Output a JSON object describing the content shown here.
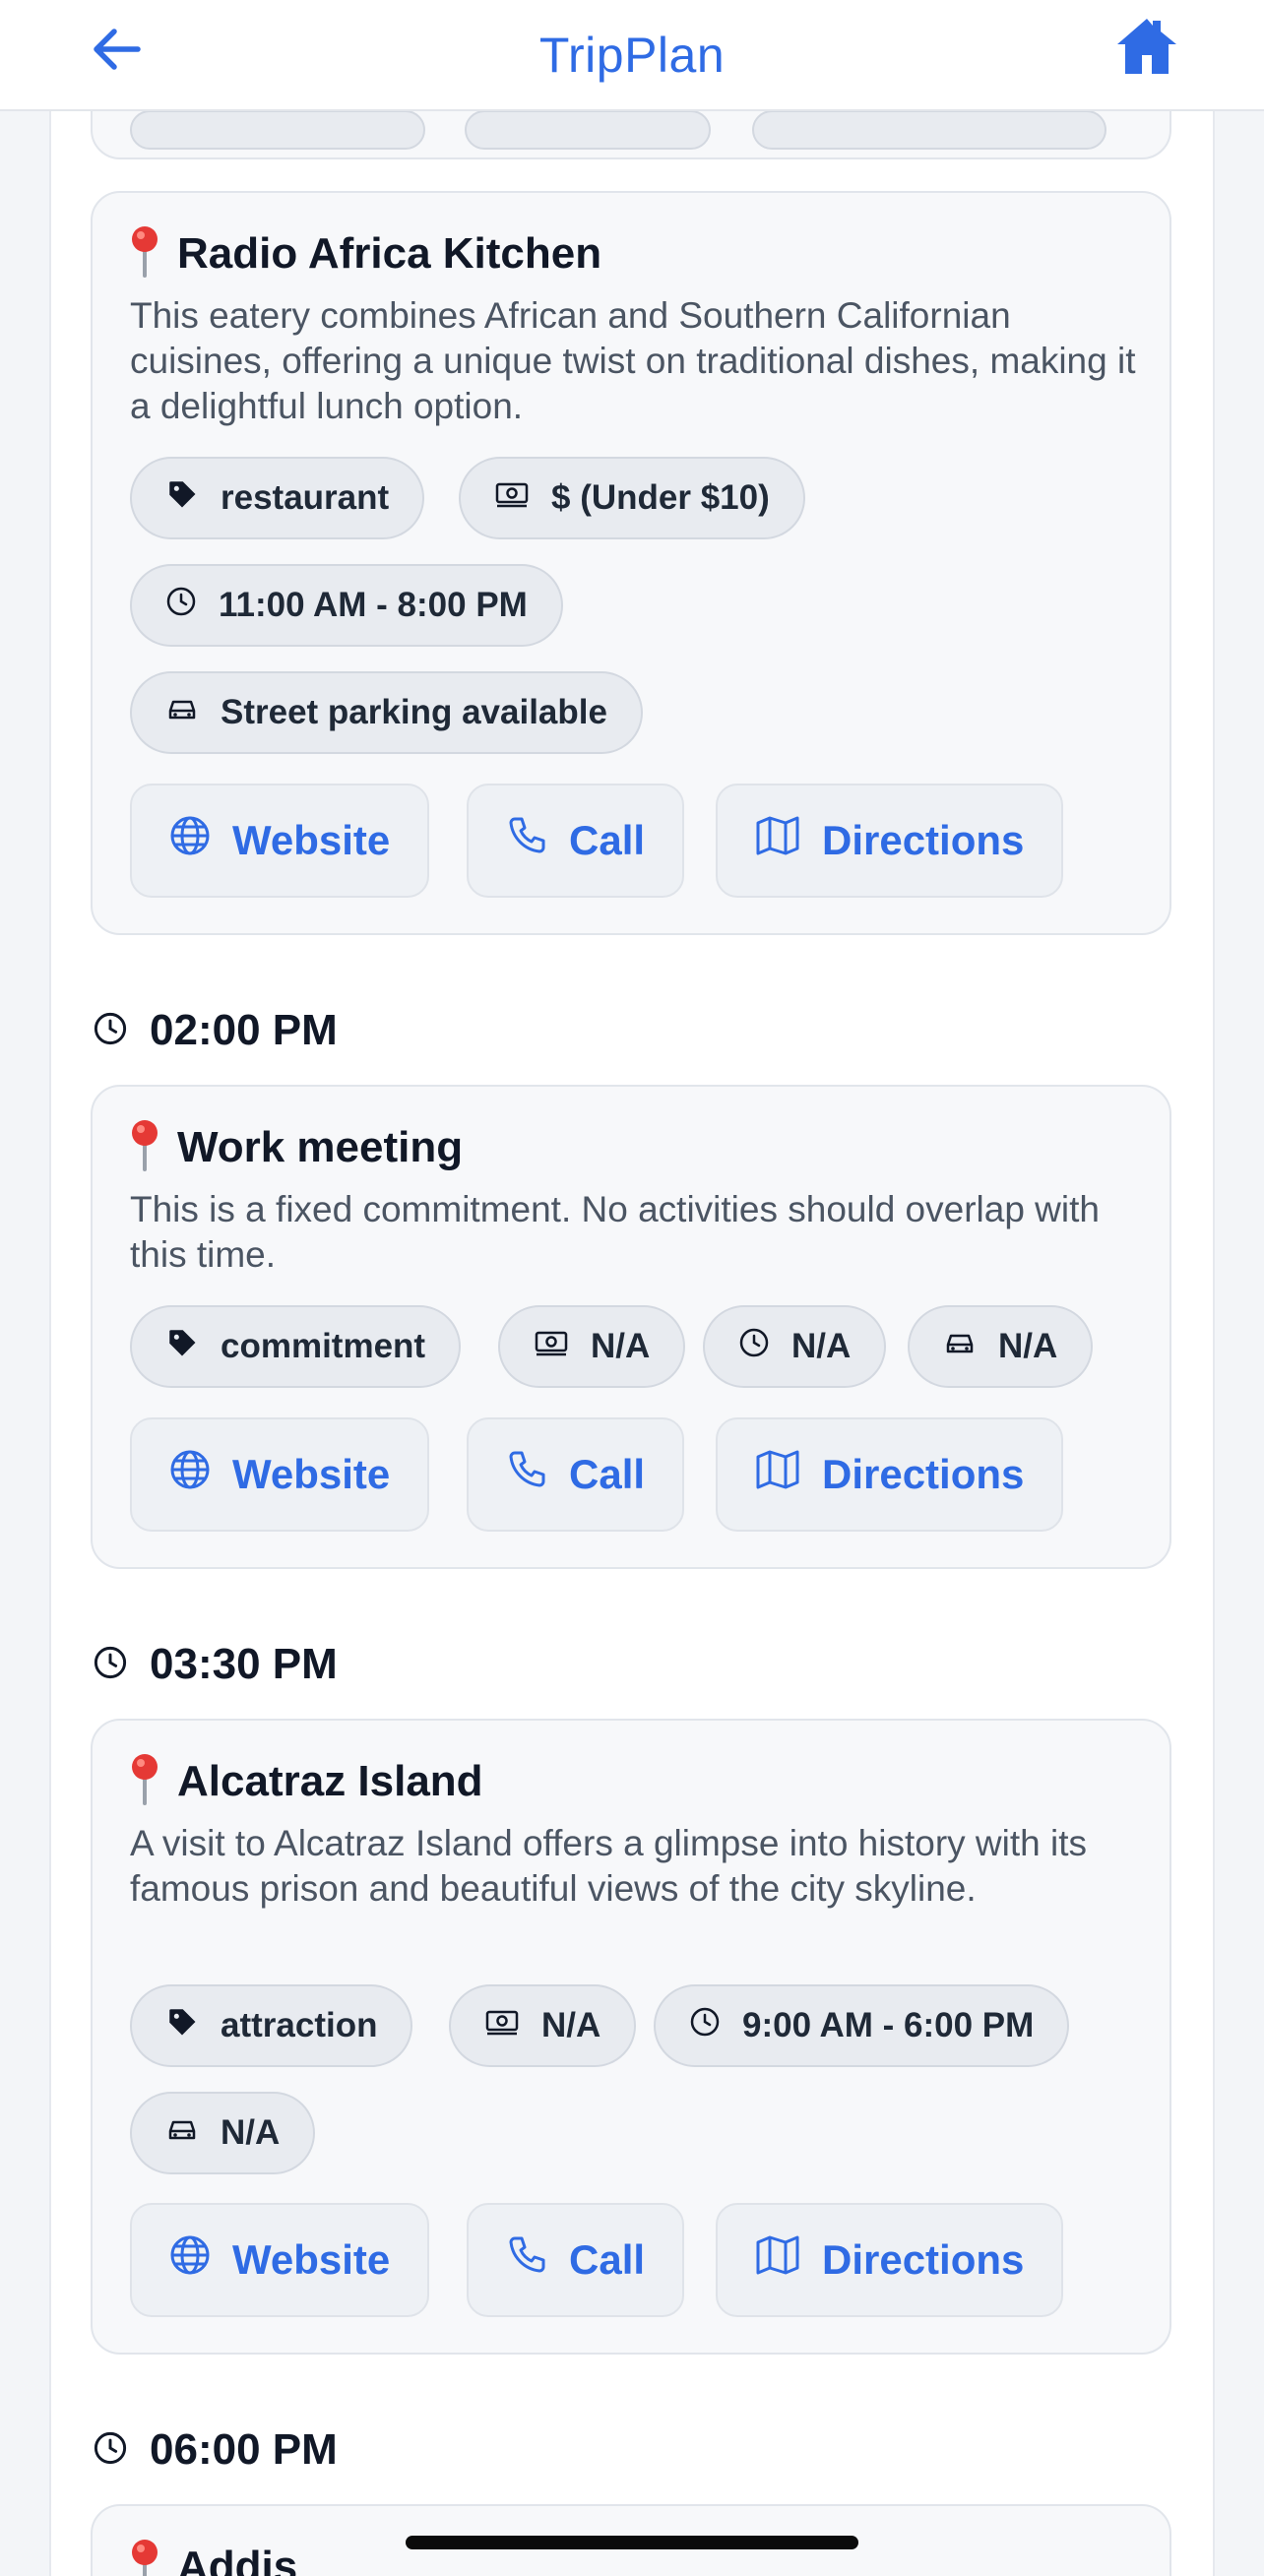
{
  "header": {
    "title": "TripPlan",
    "back_icon": "arrow-left-icon",
    "home_icon": "home-icon"
  },
  "colors": {
    "accent": "#2f6be4",
    "pin": "#e53935",
    "card_bg": "#f7f8fa",
    "chip_bg": "#e8ebf0"
  },
  "items": [
    {
      "time": "",
      "name": "Radio Africa Kitchen",
      "description": "This eatery combines African and Southern Californian cuisines, offering a unique twist on traditional dishes, making it a delightful lunch option.",
      "category": "restaurant",
      "price": "$ (Under $10)",
      "hours": "11:00 AM - 8:00 PM",
      "parking": "Street parking available"
    },
    {
      "time": "02:00 PM",
      "name": "Work meeting",
      "description": "This is a fixed commitment. No activities should overlap with this time.",
      "category": "commitment",
      "price": "N/A",
      "hours": "N/A",
      "parking": "N/A"
    },
    {
      "time": "03:30 PM",
      "name": "Alcatraz Island",
      "description": "A visit to Alcatraz Island offers a glimpse into history with its famous prison and beautiful views of the city skyline.",
      "category": "attraction",
      "price": "N/A",
      "hours": "9:00 AM - 6:00 PM",
      "parking": "N/A"
    },
    {
      "time": "06:00 PM",
      "name": "Addis"
    }
  ],
  "actions": {
    "website": "Website",
    "call": "Call",
    "directions": "Directions"
  }
}
